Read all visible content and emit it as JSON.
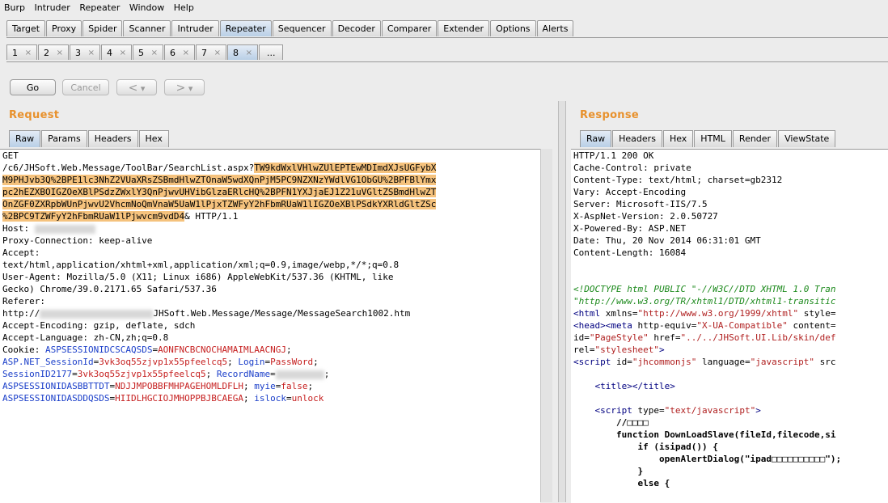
{
  "menu": [
    "Burp",
    "Intruder",
    "Repeater",
    "Window",
    "Help"
  ],
  "main_tabs": [
    "Target",
    "Proxy",
    "Spider",
    "Scanner",
    "Intruder",
    "Repeater",
    "Sequencer",
    "Decoder",
    "Comparer",
    "Extender",
    "Options",
    "Alerts"
  ],
  "main_tab_selected": "Repeater",
  "request_tabs": [
    "1",
    "2",
    "3",
    "4",
    "5",
    "6",
    "7",
    "8",
    "..."
  ],
  "request_tab_selected": "8",
  "toolbar": {
    "go": "Go",
    "cancel": "Cancel",
    "back": "<",
    "back_menu": "▾",
    "fwd": ">",
    "fwd_menu": "▾"
  },
  "request": {
    "title": "Request",
    "tabs": [
      "Raw",
      "Params",
      "Headers",
      "Hex"
    ],
    "lines": [
      "GET",
      "/c6/JHSoft.Web.Message/ToolBar/SearchList.aspx?",
      "TW9kdWxlVHlwZUlEPTEwMDImdXJsUGFybX",
      "M9PHJvb3Q%2BPE1lc3NhZ2VUaXRsZSBmdHlwZTOnaW5wdXQnPjM5PC9NZXNzYWdlVG1ObGU%2BPFBlYmx",
      "pc2hEZXBOIGZOeXBlPSdzZWxlY3QnPjwvUHVibGlzaERlcHQ%2BPFN1YXJjaEJ1Z21uVGltZSBmdHlwZT",
      "OnZGF0ZXRpbWUnPjwvU2VhcmNoQmVnaW5UaW1lPjxTZWFyY2hFbmRUaW1lIGZOeXBlPSdkYXRldGltZSc",
      "%2BPC9TZWFyY2hFbmRUaW1lPjwvcm9vdD4",
      "& HTTP/1.1",
      "Host: ",
      "Proxy-Connection: keep-alive",
      "Accept:",
      "text/html,application/xhtml+xml,application/xml;q=0.9,image/webp,*/*;q=0.8",
      "User-Agent: Mozilla/5.0 (X11; Linux i686) AppleWebKit/537.36 (KHTML, like",
      "Gecko) Chrome/39.0.2171.65 Safari/537.36",
      "Referer:",
      "http://",
      "JHSoft.Web.Message/Message/MessageSearch1002.htm",
      "Accept-Encoding: gzip, deflate, sdch",
      "Accept-Language: zh-CN,zh;q=0.8",
      "Cookie: ",
      "ASPSESSIONIDCSCAQSDS",
      "=",
      "AONFNCBCNOCHAMAIMLAACNGJ",
      "ASP.NET_SessionId",
      "=",
      "3vk3oq55zjvp1x55pfeelcq5",
      "; ",
      "Login",
      "=",
      "PassWord",
      "SessionID2177",
      "=",
      "3vk3oq55zjvp1x55pfeelcq5",
      "; ",
      "RecordName",
      "=",
      "ASPSESSIONIDASBBTTDT",
      "=",
      "NDJJMPOBBFMHPAGEHOMLDFLH",
      "; ",
      "myie",
      "=",
      "false",
      "ASPSESSIONIDASDDQSDS",
      "=",
      "HIIDLHGCIOJMHOPPBJBCAEGA",
      "; ",
      "islock",
      "=",
      "unlock"
    ]
  },
  "response": {
    "title": "Response",
    "tabs": [
      "Raw",
      "Headers",
      "Hex",
      "HTML",
      "Render",
      "ViewState"
    ],
    "headers": [
      "HTTP/1.1 200 OK",
      "Cache-Control: private",
      "Content-Type: text/html; charset=gb2312",
      "Vary: Accept-Encoding",
      "Server: Microsoft-IIS/7.5",
      "X-AspNet-Version: 2.0.50727",
      "X-Powered-By: ASP.NET",
      "Date: Thu, 20 Nov 2014 06:31:01 GMT",
      "Content-Length: 16084"
    ],
    "body": {
      "doctype1": "<!DOCTYPE html PUBLIC \"-//W3C//DTD XHTML 1.0 Tran",
      "doctype2": "\"http://www.w3.org/TR/xhtml1/DTD/xhtml1-transitic",
      "html_tag": "<html",
      "html_attr": " xmlns",
      "html_eq": "=",
      "html_val": "\"http://www.w3.org/1999/xhtml\"",
      "html_style": " style=",
      "head_tag": "<head><meta",
      "head_attr": " http-equiv",
      "head_val": "\"X-UA-Compatible\"",
      "head_content": " content=",
      "id_attr": "id",
      "id_val": "\"PageStyle\"",
      "href_attr": " href",
      "href_val": "\"../../JHSoft.UI.Lib/skin/def",
      "rel_attr": "rel",
      "rel_val": "\"stylesheet\"",
      "script_tag": "<script",
      "script_id": " id",
      "script_id_val": "\"jhcommonjs\"",
      "script_lang": " language",
      "script_lang_val": "\"javascript\"",
      "script_src": " src",
      "title_tag": "<title></title>",
      "script2_tag": "<script",
      "script2_type": " type",
      "script2_val": "\"text/javascript\"",
      "script2_end": ">",
      "comment": "//□□□□",
      "fn": "function DownLoadSlave(fileId,filecode,si",
      "if": "if (isipad()) {",
      "open": "openAlertDialog(\"ipad□□□□□□□□□□\");",
      "close": "}",
      "else": "else {"
    }
  }
}
